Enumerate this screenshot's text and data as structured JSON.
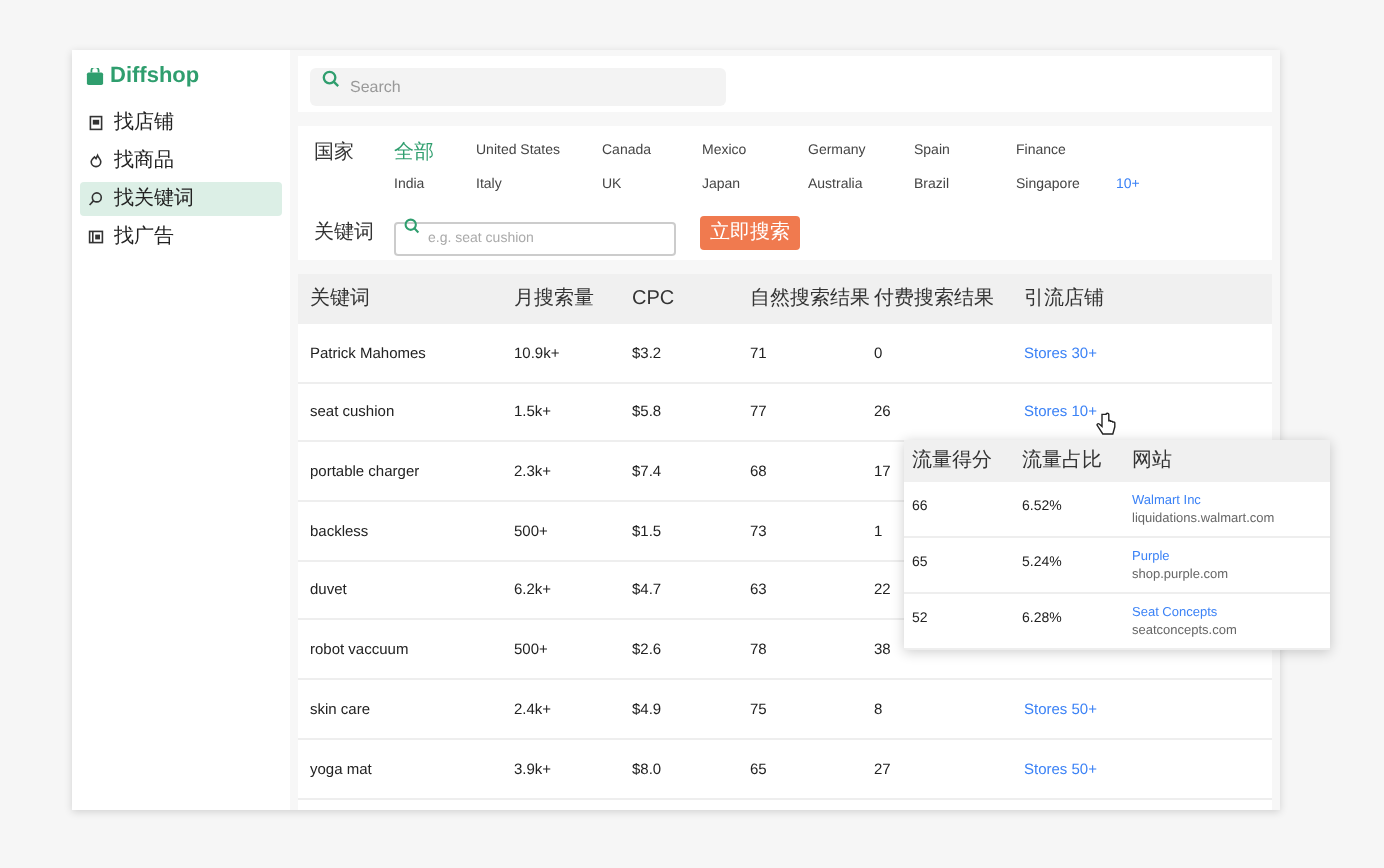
{
  "sidebar": {
    "logo": "Diffshop",
    "items": [
      {
        "label": "找店铺",
        "selected": false
      },
      {
        "label": "找商品",
        "selected": false
      },
      {
        "label": "找关键词",
        "selected": true
      },
      {
        "label": "找广告",
        "selected": false
      }
    ]
  },
  "search": {
    "placeholder": "Search"
  },
  "filters": {
    "country_label": "国家",
    "countries": [
      {
        "label": "全部",
        "selected": true
      },
      {
        "label": "United States",
        "selected": false
      },
      {
        "label": "Canada",
        "selected": false
      },
      {
        "label": "Mexico",
        "selected": false
      },
      {
        "label": "Germany",
        "selected": false
      },
      {
        "label": "Spain",
        "selected": false
      },
      {
        "label": "Finance",
        "selected": false
      },
      {
        "label": "India",
        "selected": false
      },
      {
        "label": "Italy",
        "selected": false
      },
      {
        "label": "UK",
        "selected": false
      },
      {
        "label": "Japan",
        "selected": false
      },
      {
        "label": "Australia",
        "selected": false
      },
      {
        "label": "Brazil",
        "selected": false
      },
      {
        "label": "Singapore",
        "selected": false
      }
    ],
    "more": "10+",
    "keyword_label": "关键词",
    "keyword_placeholder": "e.g. seat cushion",
    "search_button": "立即搜索"
  },
  "table": {
    "columns": [
      "关键词",
      "月搜索量",
      "CPC",
      "自然搜索结果",
      "付费搜索结果",
      "引流店铺"
    ],
    "rows": [
      {
        "keyword": "Patrick Mahomes",
        "volume": "10.9k+",
        "cpc": "$3.2",
        "organic": "71",
        "paid": "0",
        "stores": "Stores 30+"
      },
      {
        "keyword": "seat cushion",
        "volume": "1.5k+",
        "cpc": "$5.8",
        "organic": "77",
        "paid": "26",
        "stores": "Stores 10+"
      },
      {
        "keyword": "portable charger",
        "volume": "2.3k+",
        "cpc": "$7.4",
        "organic": "68",
        "paid": "17"
      },
      {
        "keyword": "backless",
        "volume": "500+",
        "cpc": "$1.5",
        "organic": "73",
        "paid": "1"
      },
      {
        "keyword": "duvet",
        "volume": "6.2k+",
        "cpc": "$4.7",
        "organic": "63",
        "paid": "22"
      },
      {
        "keyword": "robot vaccuum",
        "volume": "500+",
        "cpc": "$2.6",
        "organic": "78",
        "paid": "38"
      },
      {
        "keyword": "skin care",
        "volume": "2.4k+",
        "cpc": "$4.9",
        "organic": "75",
        "paid": "8",
        "stores": "Stores 50+"
      },
      {
        "keyword": "yoga mat",
        "volume": "3.9k+",
        "cpc": "$8.0",
        "organic": "65",
        "paid": "27",
        "stores": "Stores 50+"
      }
    ]
  },
  "popup": {
    "columns": [
      "流量得分",
      "流量占比",
      "网站"
    ],
    "rows": [
      {
        "score": "66",
        "share": "6.52%",
        "name": "Walmart Inc",
        "domain": "liquidations.walmart.com"
      },
      {
        "score": "65",
        "share": "5.24%",
        "name": "Purple",
        "domain": "shop.purple.com"
      },
      {
        "score": "52",
        "share": "6.28%",
        "name": "Seat Concepts",
        "domain": "seatconcepts.com"
      }
    ]
  }
}
